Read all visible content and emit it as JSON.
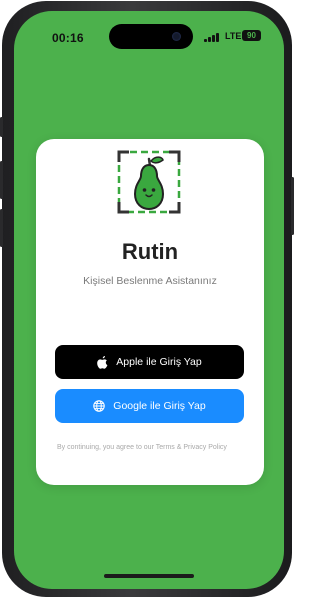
{
  "status_bar": {
    "time": "00:16",
    "network": "LTE",
    "battery": "90"
  },
  "app": {
    "title": "Rutin",
    "subtitle": "Kişisel Beslenme Asistanınız"
  },
  "buttons": {
    "apple_label": "Apple ile Giriş Yap",
    "google_label": "Google ile Giriş Yap"
  },
  "terms_text": "By continuing, you agree to our Terms & Privacy Policy",
  "colors": {
    "background_green": "#4cb14c",
    "apple_button": "#000000",
    "google_button": "#1a8cff",
    "logo_green": "#3aa83f"
  },
  "icons": {
    "logo": "pear-mascot-icon",
    "apple": "apple-icon",
    "google": "globe-icon"
  }
}
